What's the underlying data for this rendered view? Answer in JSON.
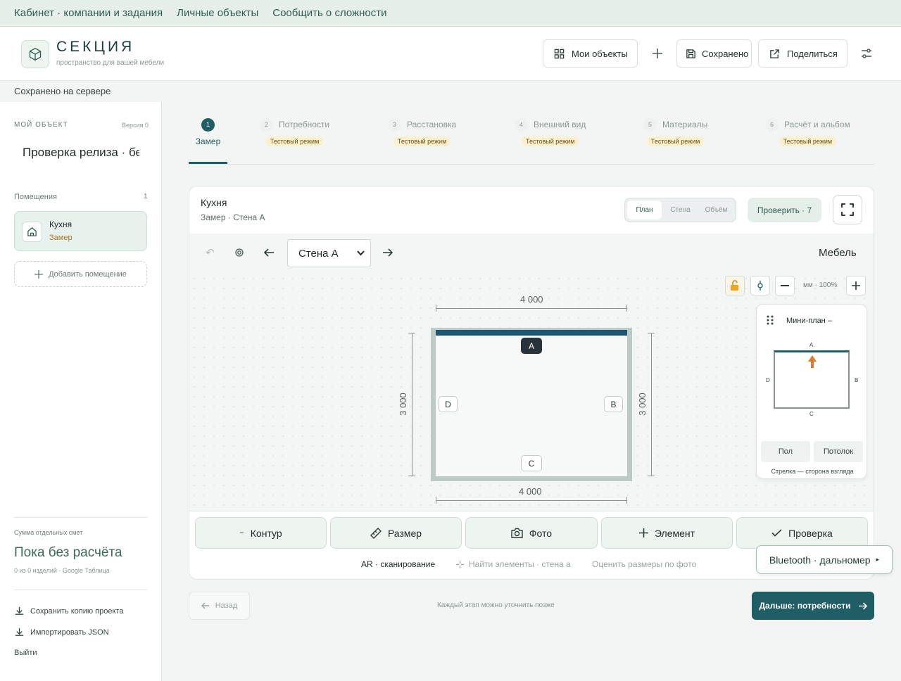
{
  "topnav": {
    "items": [
      "Кабинет · компании и задания",
      "Личные объекты",
      "Сообщить о сложности"
    ]
  },
  "header": {
    "title": "СЕКЦИЯ",
    "subtitle": "пространство для вашей мебели",
    "my_objects_label": "Мои объекты",
    "saved_label": "Сохранено",
    "share_label": "Поделиться"
  },
  "status": {
    "text": "Сохранено на сервере"
  },
  "sidebar": {
    "section_label": "МОЙ ОБЪЕКТ",
    "version": "Версия 0",
    "project_name": "Проверка релиза · бе:",
    "rooms_label": "Помещения",
    "rooms_count": "1",
    "room_name": "Кухня",
    "room_stage": "Замер",
    "add_room": "Добавить помещение",
    "estimate_label": "Сумма отдельных смет",
    "estimate_value": "Пока без расчёта",
    "estimate_sub": "0 из 0 изделий · Google Таблица",
    "save_copy": "Сохранить копию проекта",
    "import_json": "Импортировать JSON",
    "logout": "Выйти"
  },
  "steps": [
    {
      "num": "1",
      "label": "Замер",
      "badge": ""
    },
    {
      "num": "2",
      "label": "Потребности",
      "badge": "Тестовый режим"
    },
    {
      "num": "3",
      "label": "Расстановка",
      "badge": "Тестовый режим"
    },
    {
      "num": "4",
      "label": "Внешний вид",
      "badge": "Тестовый режим"
    },
    {
      "num": "5",
      "label": "Материалы",
      "badge": "Тестовый режим"
    },
    {
      "num": "6",
      "label": "Расчёт и альбом",
      "badge": "Тестовый режим"
    }
  ],
  "panel": {
    "title": "Кухня",
    "subtitle": "Замер · Стена А",
    "view_modes": [
      "План",
      "Стена",
      "Объём"
    ],
    "check_label": "Проверить · 7",
    "wall_select": "Стена А",
    "furniture_label": "Мебель",
    "zoom_text": "мм · 100%",
    "dim_top": "4 000",
    "dim_bottom": "4 000",
    "dim_left": "3 000",
    "dim_right": "3 000",
    "walls": {
      "a": "A",
      "b": "B",
      "c": "C",
      "d": "D"
    }
  },
  "minimap": {
    "title": "Мини-план –",
    "floor": "Пол",
    "ceiling": "Потолок",
    "hint": "Стрелка — сторона взгляда",
    "a": "A",
    "b": "B",
    "c": "C",
    "d": "D"
  },
  "actions": {
    "contour": "Контур",
    "size": "Размер",
    "photo": "Фото",
    "element": "Элемент",
    "check": "Проверка",
    "ar": "AR · сканирование",
    "find": "Найти элементы · стена а",
    "estimate_photo": "Оценить размеры по фото",
    "bluetooth": "Bluetooth · дальномер"
  },
  "footer": {
    "back": "Назад",
    "hint": "Каждый этап можно уточнить позже",
    "next": "Дальше: потребности"
  },
  "colors": {
    "accent": "#1e5e64",
    "badge_bg": "#fdf0cf",
    "wall_active": "#1e5575",
    "arrow": "#e07a2b"
  }
}
